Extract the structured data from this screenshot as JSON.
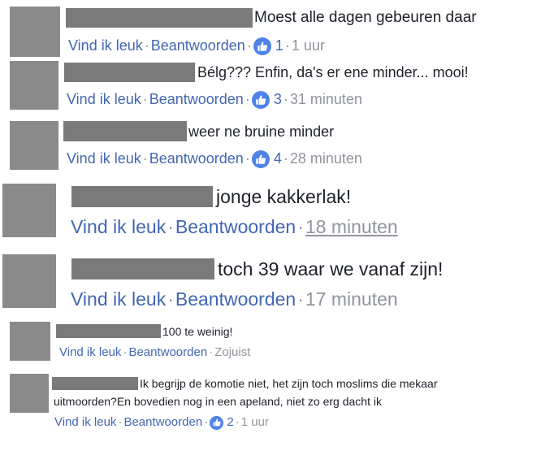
{
  "comments": [
    {
      "text": "Moest alle dagen gebeuren daar",
      "like": "Vind ik leuk",
      "reply": "Beantwoorden",
      "reactions": "1",
      "time": "1 uur"
    },
    {
      "text": "Bélg??? Enfin, da's er ene minder... mooi!",
      "like": "Vind ik leuk",
      "reply": "Beantwoorden",
      "reactions": "3",
      "time": "31 minuten"
    },
    {
      "text": "weer ne bruine minder",
      "like": "Vind ik leuk",
      "reply": "Beantwoorden",
      "reactions": "4",
      "time": "28 minuten"
    },
    {
      "text": "jonge kakkerlak!",
      "like": "Vind ik leuk",
      "reply": "Beantwoorden",
      "time": "18 minuten"
    },
    {
      "text": "toch 39 waar we vanaf zijn!",
      "like": "Vind ik leuk",
      "reply": "Beantwoorden",
      "time": "17 minuten"
    },
    {
      "text": "100 te weinig!",
      "like": "Vind ik leuk",
      "reply": "Beantwoorden",
      "time": "Zojuist"
    },
    {
      "text_line1": "Ik begrijp de komotie niet, het zijn toch moslims die mekaar",
      "text_line2": "uitmoorden?En bovedien nog in een apeland, niet zo erg dacht ik",
      "like": "Vind ik leuk",
      "reply": "Beantwoorden",
      "reactions": "2",
      "time": "1 uur"
    }
  ],
  "separator": "·",
  "colors": {
    "link": "#4267b2",
    "meta": "#90949c",
    "text": "#1d2129",
    "like_badge": "#4f82e8",
    "redaction": "#7a7a7a"
  },
  "icons": {
    "reaction": "thumbs-up-icon"
  }
}
